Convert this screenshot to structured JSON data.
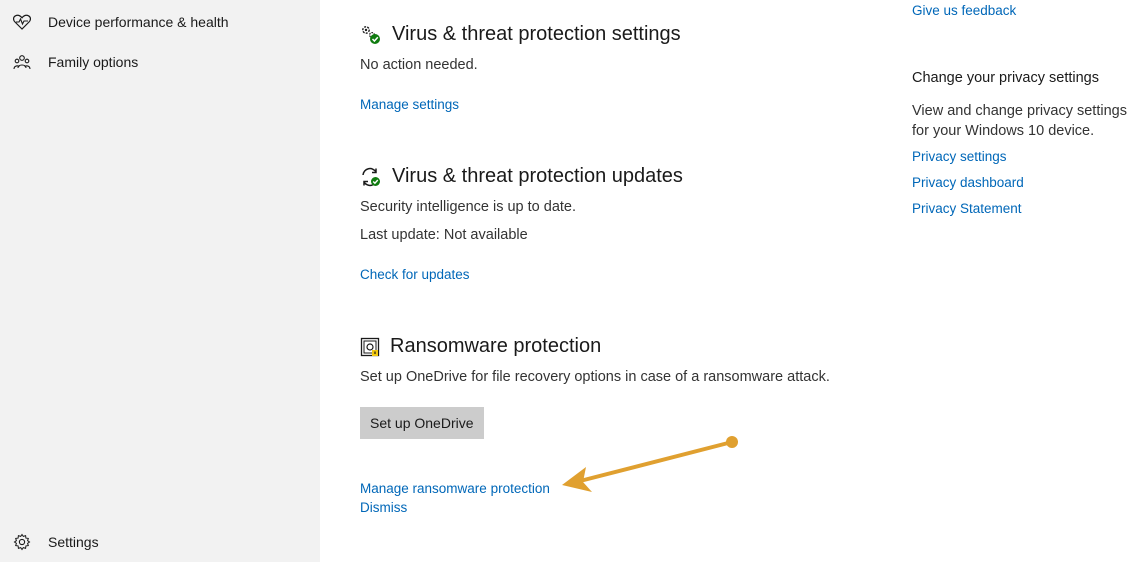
{
  "sidebar": {
    "items": [
      {
        "label": "Device performance & health",
        "icon": "heart-pulse-icon"
      },
      {
        "label": "Family options",
        "icon": "family-icon"
      }
    ],
    "settings_label": "Settings"
  },
  "main": {
    "settings_section": {
      "title": "Virus & threat protection settings",
      "status": "No action needed.",
      "link": "Manage settings"
    },
    "updates_section": {
      "title": "Virus & threat protection updates",
      "status": "Security intelligence is up to date.",
      "last_update": "Last update: Not available",
      "link": "Check for updates"
    },
    "ransomware_section": {
      "title": "Ransomware protection",
      "description": "Set up OneDrive for file recovery options in case of a ransomware attack.",
      "button": "Set up OneDrive",
      "manage_link": "Manage ransomware protection",
      "dismiss_link": "Dismiss"
    }
  },
  "right_panel": {
    "feedback_link": "Give us feedback",
    "privacy_heading": "Change your privacy settings",
    "privacy_desc": "View and change privacy settings for your Windows 10 device.",
    "links": [
      "Privacy settings",
      "Privacy dashboard",
      "Privacy Statement"
    ]
  },
  "colors": {
    "link": "#0067b8",
    "sidebar_bg": "#f2f2f2",
    "button_bg": "#cccccc",
    "annotation_arrow": "#e0a030",
    "status_ok": "#107c10"
  }
}
